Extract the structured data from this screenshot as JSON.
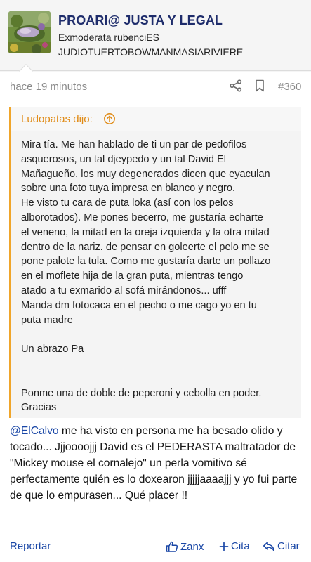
{
  "user": {
    "name": "PROARI@ JUSTA Y LEGAL",
    "title": "Exmoderata rubenciES",
    "banner": "JUDIOTUERTOBOWMANMASIARIVIERE"
  },
  "post": {
    "time": "hace 19 minutos",
    "number": "#360"
  },
  "quote": {
    "author": "Ludopatas dijo:",
    "paragraph1": "Mira tía. Me han hablado de ti un par de pedofilos\nasquerosos, un tal djeypedo y un tal David El\nMañagueño, los muy degenerados dicen que eyaculan\nsobre una foto tuya impresa en blanco y negro.\nHe visto tu cara de puta loka (así con los pelos\nalborotados). Me pones becerro, me gustaría echarte\nel veneno, la mitad en la oreja izquierda y la otra mitad\ndentro de la nariz. de pensar en goleerte el pelo me se\npone palote la tula. Como me gustaría darte un pollazo\nen el moflete hija de la gran puta, mientras tengo\natado a tu exmarido al sofá mirándonos... ufff\nManda dm fotocaca en el pecho o me cago yo en tu\nputa madre",
    "paragraph2": "Un abrazo Pa",
    "paragraph3": "Ponme una de doble de peperoni y cebolla en poder.\nGracias"
  },
  "reply": {
    "mention": "@ElCalvo",
    "text": " me ha visto en persona me ha besado olido y tocado... Jjjoooojjj David es el PEDERASTA maltratador de \"Mickey mouse el cornalejo\" un perla vomitivo sé perfectamente quién es lo doxearon jjjjjaaaajjj y yo fui parte de que lo empurasen... Qué placer !!"
  },
  "actions": {
    "report": "Reportar",
    "like": "Zanx",
    "quote": "Cita",
    "reply": "Citar"
  },
  "colors": {
    "username": "#1e2c6b",
    "link": "#1a47a6",
    "quote_accent": "#f0a52a",
    "quote_author": "#e08a14"
  }
}
